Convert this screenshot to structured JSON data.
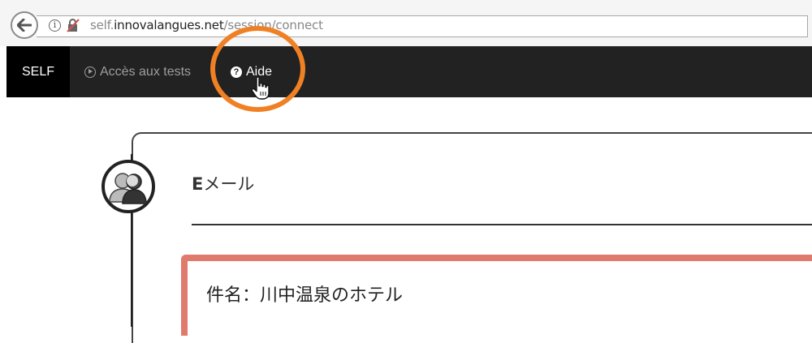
{
  "browser": {
    "url_prefix": "self.",
    "url_domain": "innovalangues.net",
    "url_path": "/session/connect"
  },
  "navbar": {
    "brand": "SELF",
    "items": [
      {
        "label": "Accès aux tests",
        "icon": "play-circle-icon"
      },
      {
        "label": "Aide",
        "icon": "question-circle-icon"
      }
    ]
  },
  "annotation": {
    "highlight_color": "#f08024"
  },
  "panel": {
    "title_first": "E",
    "title_rest": "メール"
  },
  "message": {
    "subject": "件名：川中温泉のホテル",
    "border_color": "#e07a6c"
  }
}
